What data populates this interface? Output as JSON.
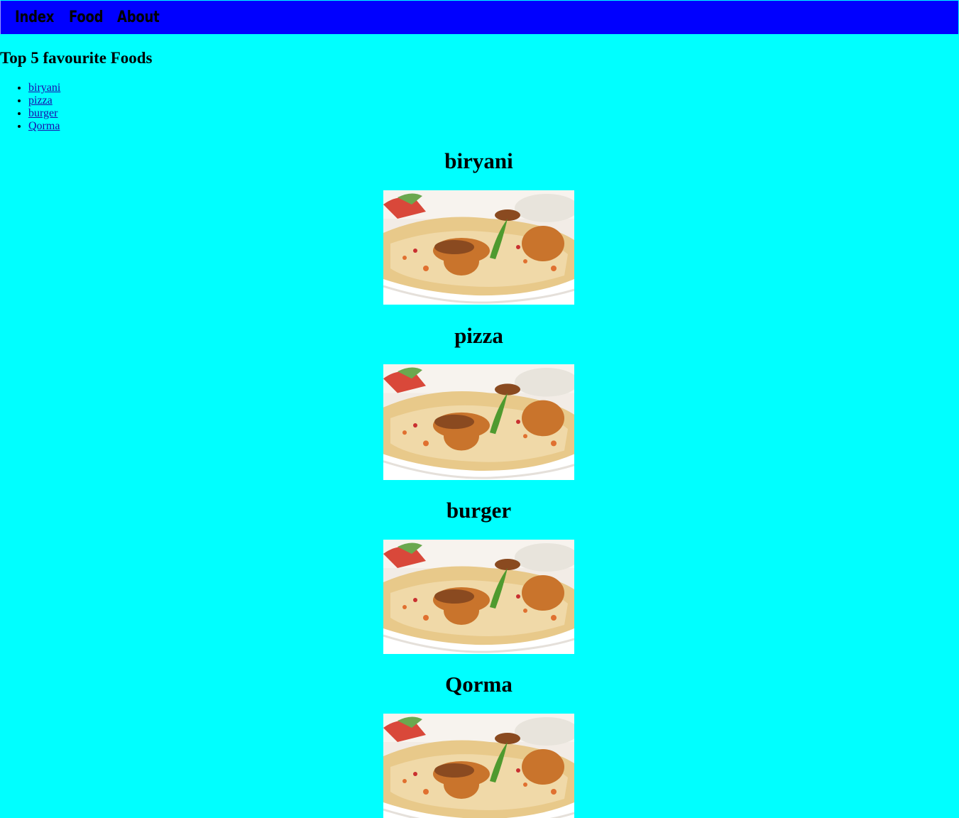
{
  "nav": {
    "items": [
      {
        "label": "Index"
      },
      {
        "label": "Food"
      },
      {
        "label": "About"
      }
    ]
  },
  "page_title": "Top 5 favourite Foods",
  "list": {
    "items": [
      {
        "label": "biryani"
      },
      {
        "label": "pizza"
      },
      {
        "label": "burger"
      },
      {
        "label": "Qorma"
      }
    ]
  },
  "sections": [
    {
      "heading": "biryani",
      "image": "biryani-food-photo"
    },
    {
      "heading": "pizza",
      "image": "biryani-food-photo"
    },
    {
      "heading": "burger",
      "image": "biryani-food-photo"
    },
    {
      "heading": "Qorma",
      "image": "biryani-food-photo"
    }
  ],
  "colors": {
    "page_background": "#00ffff",
    "navbar_background": "#0000ff",
    "link_color": "#1a0dab"
  }
}
